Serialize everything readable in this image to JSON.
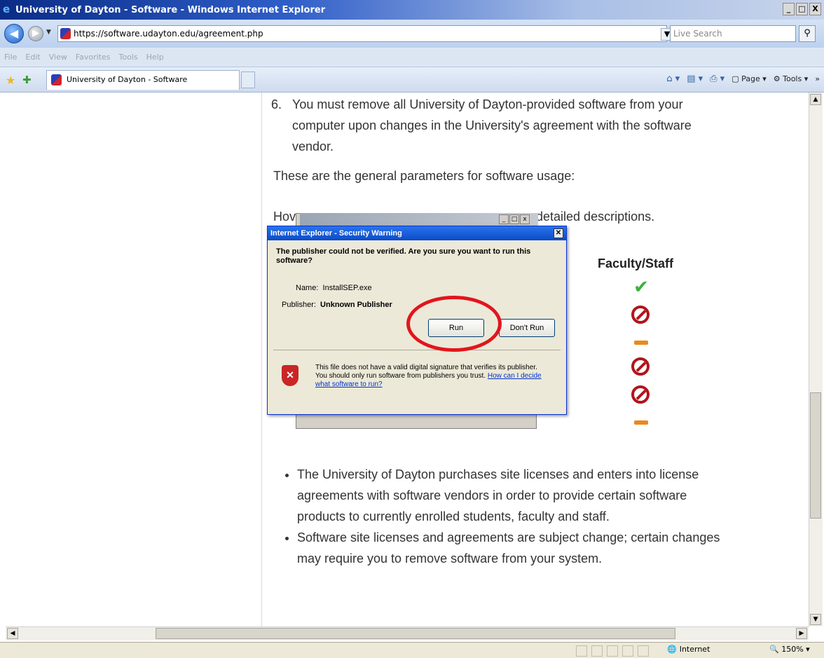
{
  "window": {
    "title": "University of Dayton - Software - Windows Internet Explorer",
    "controls": [
      "_",
      "□",
      "X"
    ]
  },
  "address_bar": {
    "url": "https://software.udayton.edu/agreement.php",
    "search_placeholder": "Live Search"
  },
  "menu": {
    "items": [
      "File",
      "Edit",
      "View",
      "Favorites",
      "Tools",
      "Help"
    ]
  },
  "favorites_bar": {
    "tab_title": "University of Dayton - Software",
    "commands": [
      "Page",
      "Tools"
    ]
  },
  "page": {
    "item6_number": "6.",
    "item6_text": "You must remove all University of Dayton-provided software from your computer upon changes in the University's agreement with the software vendor.",
    "general_params": "These are the general parameters for software usage:",
    "however_start": "Hove",
    "however_end": "detailed descriptions.",
    "faculty_header": "Faculty/Staff",
    "bullets": [
      "The University of Dayton purchases site licenses and enters into license agreements with software vendors in order to provide certain software products to currently enrolled students, faculty and staff.",
      "Software site licenses and agreements are subject change; certain changes may require you to remove software from your system."
    ]
  },
  "security_dialog": {
    "title": "Internet Explorer - Security Warning",
    "question": "The publisher could not be verified. Are you sure you want to run this software?",
    "name_label": "Name:",
    "name_value": "InstallSEP.exe",
    "publisher_label": "Publisher:",
    "publisher_value": "Unknown Publisher",
    "run_button": "Run",
    "dont_run_button": "Don't Run",
    "warning_text": "This file does not have a valid digital signature that verifies its publisher. You should only run software from publishers you trust.",
    "warning_link": "How can I decide what software to run?"
  },
  "status_bar": {
    "zone": "Internet",
    "zoom": "150%"
  },
  "colors": {
    "titlebar": "#0a2c86",
    "dialog_title": "#0a4ac9",
    "highlight_circle": "#e2151d",
    "check": "#3ab23a",
    "deny": "#b0151c"
  }
}
